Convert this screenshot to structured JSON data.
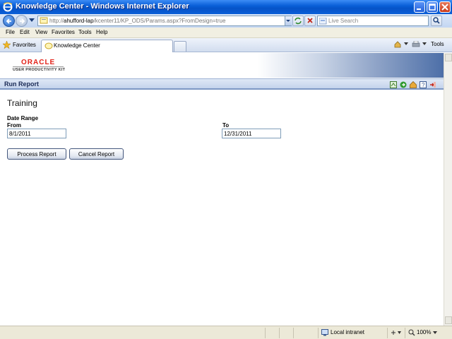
{
  "window": {
    "title": "Knowledge Center - Windows Internet Explorer"
  },
  "address_bar": {
    "url_prefix": "http://",
    "url_host": "ahufford-lap",
    "url_path": "/kcenter11/KP_ODS/Params.aspx?FromDesign=true",
    "search_placeholder": "Live Search"
  },
  "menu": {
    "items": [
      "File",
      "Edit",
      "View",
      "Favorites",
      "Tools",
      "Help"
    ]
  },
  "favorites_bar": {
    "favorites_label": "Favorites",
    "active_tab": "Knowledge Center",
    "tools_label": "Tools"
  },
  "banner": {
    "brand": "ORACLE",
    "product": "USER PRODUCTIVITY KIT"
  },
  "toolbar": {
    "heading": "Run Report"
  },
  "report": {
    "title": "Training",
    "date_range_label": "Date Range",
    "from_label": "From",
    "from_value": "8/1/2011",
    "to_label": "To",
    "to_value": "12/31/2011",
    "process_button": "Process Report",
    "cancel_button": "Cancel Report"
  },
  "status_bar": {
    "zone": "Local intranet",
    "zoom": "100%"
  },
  "colors": {
    "titlebar": "#0a5fd8",
    "oracle_red": "#e32219",
    "toolbar_border": "#7d97c4"
  }
}
